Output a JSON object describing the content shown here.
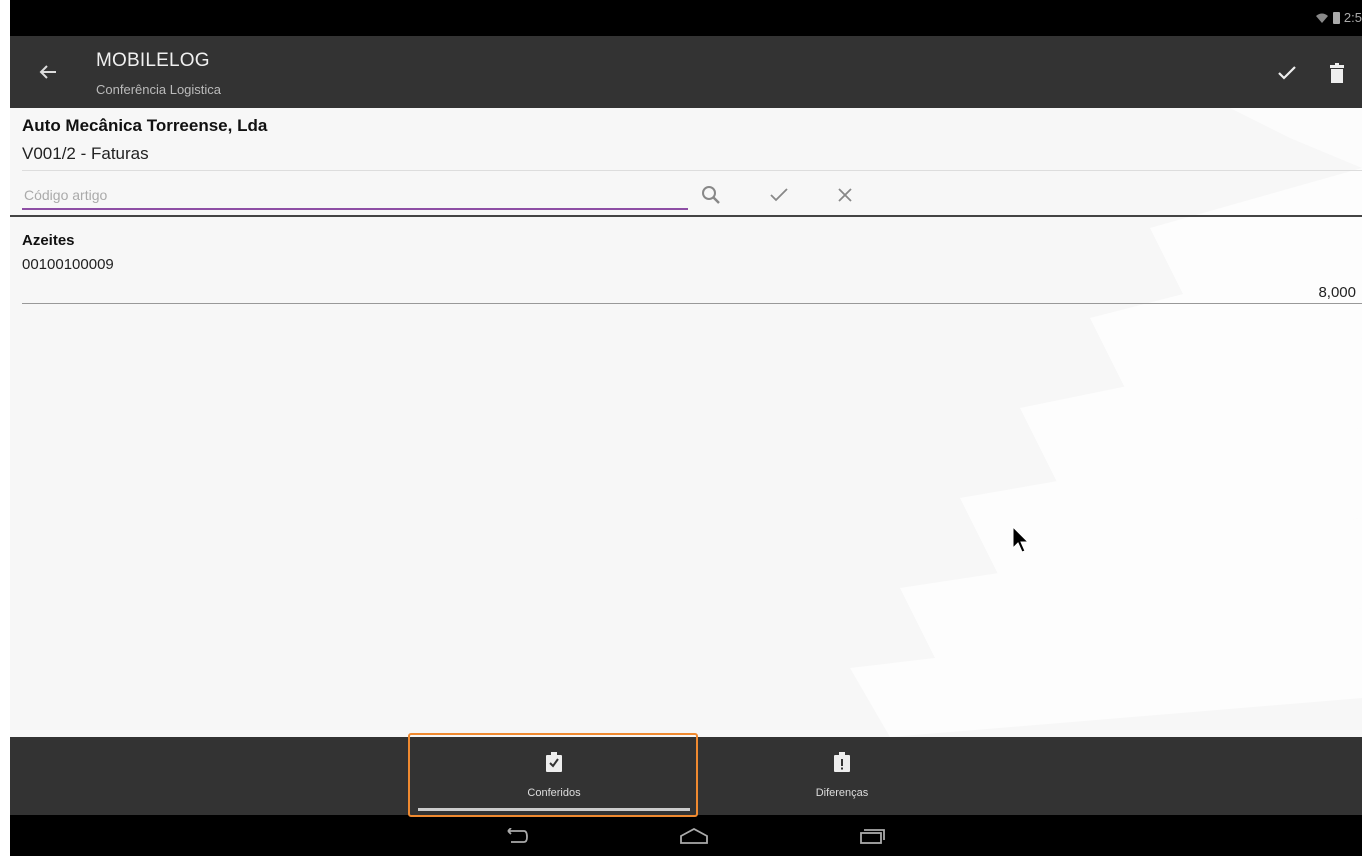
{
  "status_bar": {
    "time": "2:5"
  },
  "action_bar": {
    "title": "MOBILELOG",
    "subtitle": "Conferência Logistica",
    "back_icon": "arrow-left-icon",
    "actions": [
      "check-icon",
      "trash-icon"
    ]
  },
  "document": {
    "customer": "Auto Mecânica Torreense, Lda",
    "reference": "V001/2 - Faturas"
  },
  "search": {
    "placeholder": "Código artigo",
    "value": "",
    "tools": [
      "search-icon",
      "check-icon",
      "close-icon"
    ]
  },
  "items": [
    {
      "name": "Azeites",
      "code": "00100100009",
      "quantity": "8,000"
    }
  ],
  "bottom_tabs": [
    {
      "label": "Conferidos",
      "icon": "clipboard-check-icon",
      "selected": true
    },
    {
      "label": "Diferenças",
      "icon": "clipboard-alert-icon",
      "selected": false
    }
  ],
  "colors": {
    "action_bar": "#333333",
    "input_underline": "#8e4fa5",
    "highlight": "#f08a30"
  }
}
